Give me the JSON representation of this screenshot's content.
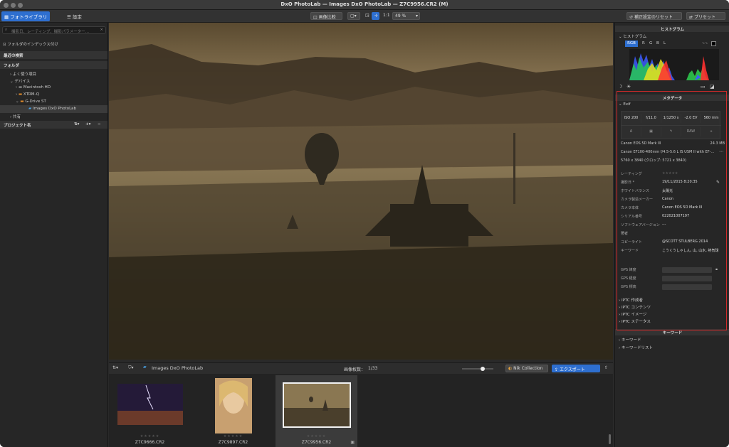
{
  "window": {
    "title": "DxO PhotoLab — Images DxO PhotoLab — Z7C9956.CR2 (M)"
  },
  "toolbar": {
    "tabs": [
      {
        "label": "フォトライブラリ"
      },
      {
        "label": "設定"
      }
    ],
    "compare_label": "画像比較",
    "zoom_1to1": "1:1",
    "zoom_percent": "49 %",
    "reset_label": "補正設定のリセット",
    "preset_label": "プリセット"
  },
  "left_panel": {
    "search_placeholder": "撮影日、レーティング、撮影パラメーター…",
    "index_folder_label": "フォルダのインデックス付け",
    "recent_searches_header": "最近の検索",
    "folders_header": "フォルダ",
    "folders": [
      {
        "label": "よく使う項目"
      },
      {
        "label": "デバイス"
      },
      {
        "label": "Macintosh HD"
      },
      {
        "label": "XTRM-Q"
      },
      {
        "label": "G-Drive ST"
      },
      {
        "label": "Images DxO PhotoLab"
      },
      {
        "label": "共有"
      }
    ],
    "projects_header": "プロジェクト名"
  },
  "filmstrip_bar": {
    "folder_name": "Images DxO PhotoLab",
    "image_count_label": "画像枚数：",
    "image_count": "1/33",
    "nik_label": "Nik Collection",
    "export_label": "エクスポート",
    "slider_level": 0.6
  },
  "filmstrip": {
    "thumbnails": [
      {
        "name": "Z7C9666.CR2",
        "stars": "★★★★★"
      },
      {
        "name": "Z7C9897.CR2",
        "stars": "★★★★★"
      },
      {
        "name": "Z7C9956.CR2",
        "stars": "★★★★★"
      }
    ]
  },
  "right_panel": {
    "histogram_header": "ヒストグラム",
    "histogram_sub": "ヒストグラム",
    "channels": [
      "RGB",
      "R",
      "G",
      "B",
      "L"
    ],
    "metadata_header": "メタデータ",
    "exif_label": "Exif",
    "exif_values": [
      "ISO 200",
      "f/11.0",
      "1/1250 s",
      "-2.0 EV",
      "560 mm"
    ],
    "exif_icons": [
      "A",
      "",
      "",
      "RAW",
      ""
    ],
    "camera": "Canon EOS 5D Mark III",
    "filesize": "24.3 MB",
    "lens": "Canon EF100-400mm f/4.5-5.6 L IS USM II with EF-…",
    "dimensions": "5760 x 3840 (クロップ: 5721 x 3840)",
    "fields": [
      {
        "label": "レーティング",
        "value": "★★★★★"
      },
      {
        "label": "撮影日 *",
        "value": "19/11/2015 8:20:35"
      },
      {
        "label": "ホワイトバランス",
        "value": "太陽光"
      },
      {
        "label": "カメラ製造メーカー",
        "value": "Canon"
      },
      {
        "label": "カメラ本体",
        "value": "Canon EOS 5D Mark III"
      },
      {
        "label": "シリアル番号",
        "value": "022021007197"
      },
      {
        "label": "ソフトウェアバージョン",
        "value": "---"
      },
      {
        "label": "著者",
        "value": ""
      },
      {
        "label": "コピーライト",
        "value": "@SCOTT STULBERG 2014"
      },
      {
        "label": "キーワード",
        "value": "こうくうしゃしん, 山, 山水, 熱気球"
      }
    ],
    "gps": [
      {
        "label": "GPS 緯度"
      },
      {
        "label": "GPS 経度"
      },
      {
        "label": "GPS 標高"
      }
    ],
    "iptc": [
      {
        "label": "IPTC 作成者"
      },
      {
        "label": "IPTC コンテンツ"
      },
      {
        "label": "IPTC イメージ"
      },
      {
        "label": "IPTC ステータス"
      }
    ],
    "keywords_header": "キーワード",
    "keyword_items": [
      {
        "label": "キーワード"
      },
      {
        "label": "キーワードリスト"
      }
    ]
  }
}
